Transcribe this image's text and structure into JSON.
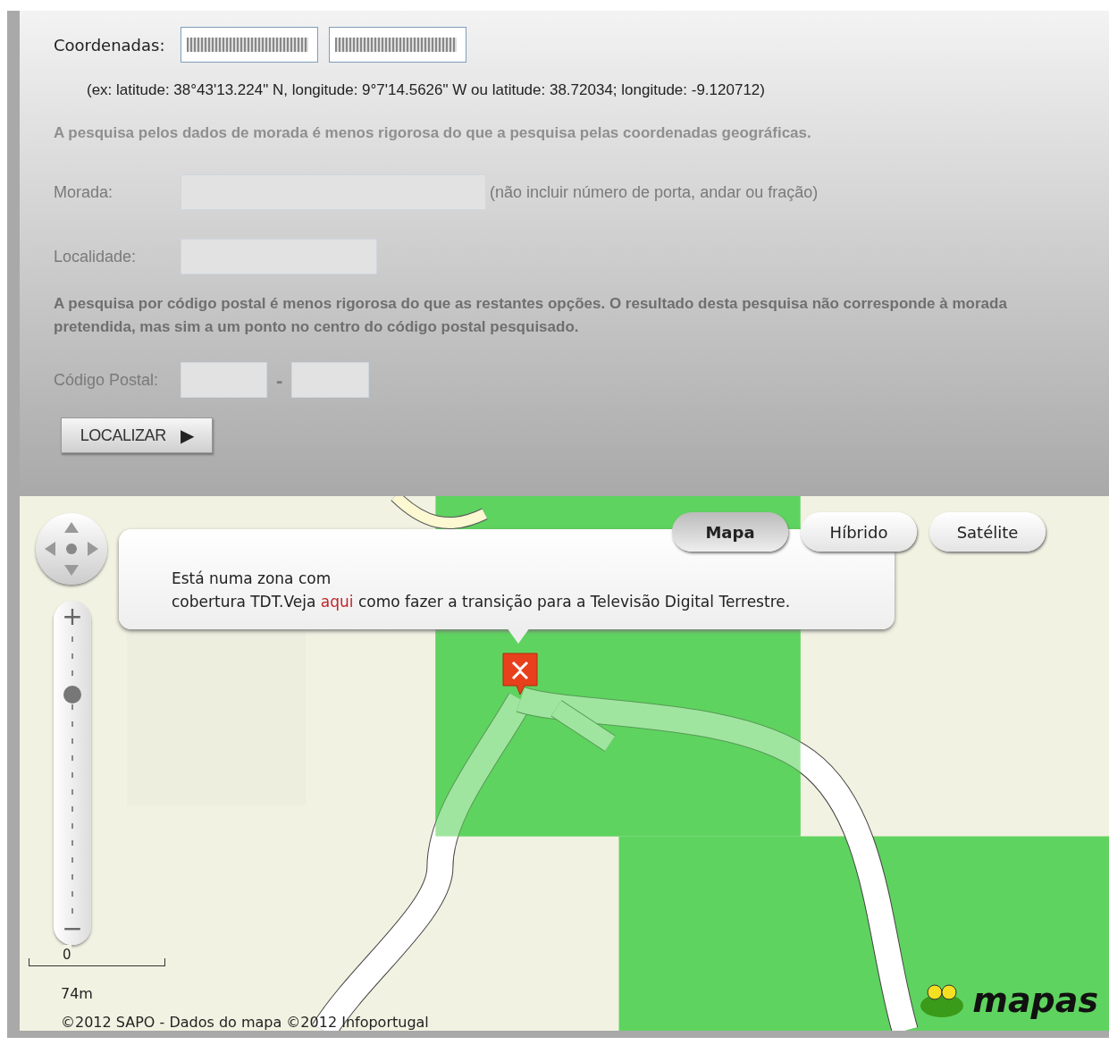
{
  "form": {
    "coordinates": {
      "label": "Coordenadas:",
      "example": "(ex: latitude: 38°43'13.224\" N, longitude: 9°7'14.5626\" W ou latitude: 38.72034; longitude: -9.120712)"
    },
    "address_note": "A pesquisa pelos dados de morada é menos rigorosa do que a pesquisa pelas coordenadas geográficas.",
    "address": {
      "label": "Morada:",
      "hint": "(não incluir número de porta, andar ou fração)",
      "disabled": true
    },
    "locality": {
      "label": "Localidade:",
      "disabled": true
    },
    "postal_note": "A pesquisa por código postal é menos rigorosa do que as restantes opções. O resultado desta pesquisa não corresponde à morada pretendida, mas sim a um ponto no centro do código postal pesquisado.",
    "postal_code": {
      "label": "Código Postal:",
      "separator": "-",
      "disabled": true
    },
    "submit": {
      "label": "LOCALIZAR",
      "arrow": "▶"
    }
  },
  "map": {
    "map_types": [
      {
        "label": "Mapa",
        "selected": true
      },
      {
        "label": "Híbrido",
        "selected": false
      },
      {
        "label": "Satélite",
        "selected": false
      }
    ],
    "popup": {
      "line1": "Está numa zona com",
      "before": "cobertura TDT.Veja ",
      "link": "aqui",
      "after": " como fazer a transição para a Televisão Digital Terrestre."
    },
    "zoom": {
      "plus": "+",
      "minus": "−",
      "level": 0.79
    },
    "scale": {
      "zero": "0",
      "distance": "74m"
    },
    "copyright": "©2012 SAPO - Dados do mapa ©2012 Infoportugal",
    "logo": "mapas"
  }
}
